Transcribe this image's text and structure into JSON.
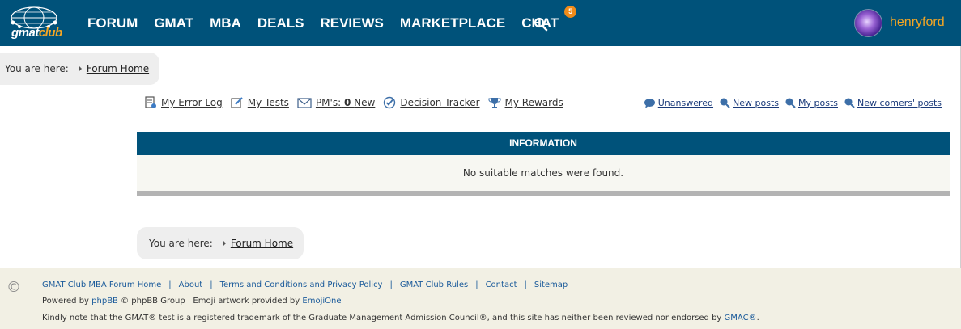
{
  "header": {
    "logo_text_a": "gmat",
    "logo_text_b": "club",
    "nav": [
      "FORUM",
      "GMAT",
      "MBA",
      "DEALS",
      "REVIEWS",
      "MARKETPLACE",
      "CHAT"
    ],
    "chat_badge": "5",
    "username": "henryford",
    "bg_color": "#00527a",
    "username_color": "#f5a623"
  },
  "breadcrumb": {
    "label": "You are here:",
    "link": "Forum Home"
  },
  "quicklinks": {
    "error_log": "My Error Log",
    "tests": "My Tests",
    "pms_prefix": "PM's:",
    "pms_count": "0",
    "pms_suffix": "New",
    "tracker": "Decision Tracker",
    "rewards": "My Rewards"
  },
  "searchlinks": [
    "Unanswered",
    "New posts",
    "My posts",
    "New comers' posts"
  ],
  "info": {
    "title": "INFORMATION",
    "message": "No suitable matches were found."
  },
  "footer": {
    "links": [
      "GMAT Club MBA Forum Home",
      "About",
      "Terms and Conditions and Privacy Policy",
      "GMAT Club Rules",
      "Contact",
      "Sitemap"
    ],
    "powered_prefix": "Powered by",
    "phpbb": "phpBB",
    "powered_mid": "© phpBB Group | Emoji artwork provided by",
    "emojione": "EmojiOne",
    "disclaimer": "Kindly note that the GMAT® test is a registered trademark of the Graduate Management Admission Council®, and this site has neither been reviewed nor endorsed by",
    "gmac": "GMAC®",
    "period": "."
  }
}
